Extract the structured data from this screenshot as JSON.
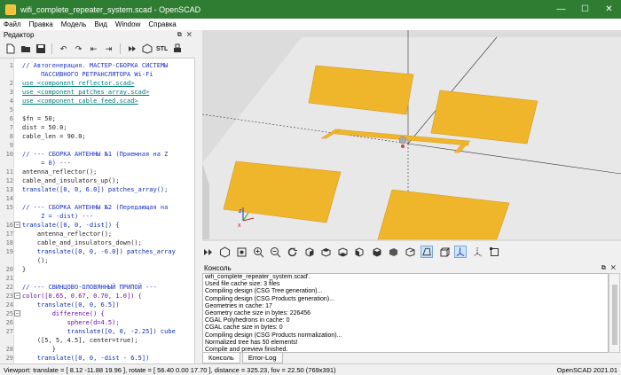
{
  "window": {
    "title": "wifi_complete_repeater_system.scad - OpenSCAD"
  },
  "menu": [
    "Файл",
    "Правка",
    "Модель",
    "Вид",
    "Window",
    "Справка"
  ],
  "editor": {
    "title": "Редактор",
    "export_label": "STL",
    "lines": [
      {
        "n": "1",
        "t": "// Автогенерация. МАСТЕР-СБОРКА СИСТЕМЫ",
        "c": "comment"
      },
      {
        "n": "",
        "t": "     ПАССИВНОГО РЕТРАНСЛЯТОРА Wi-Fi",
        "c": "comment"
      },
      {
        "n": "2",
        "t": "use <component_reflector.scad>",
        "c": "use"
      },
      {
        "n": "3",
        "t": "use <component_patches_array.scad>",
        "c": "use"
      },
      {
        "n": "4",
        "t": "use <component_cable_feed.scad>",
        "c": "use"
      },
      {
        "n": "5",
        "t": "",
        "c": "plain"
      },
      {
        "n": "6",
        "t": "$fn = 50;",
        "c": "plain"
      },
      {
        "n": "7",
        "t": "dist = 50.0;",
        "c": "plain"
      },
      {
        "n": "8",
        "t": "cable_len = 90.0;",
        "c": "plain"
      },
      {
        "n": "9",
        "t": "",
        "c": "plain"
      },
      {
        "n": "10",
        "t": "// --- СБОРКА АНТЕННЫ №1 (Приемная на Z",
        "c": "comment"
      },
      {
        "n": "",
        "t": "     = 0) ---",
        "c": "comment"
      },
      {
        "n": "11",
        "t": "antenna_reflector();",
        "c": "plain"
      },
      {
        "n": "12",
        "t": "cable_and_insulators_up();",
        "c": "plain"
      },
      {
        "n": "13",
        "t": "translate([0, 0, 6.0]) patches_array();",
        "c": "kw"
      },
      {
        "n": "14",
        "t": "",
        "c": "plain"
      },
      {
        "n": "15",
        "t": "// --- СБОРКА АНТЕННЫ №2 (Передающая на",
        "c": "comment"
      },
      {
        "n": "",
        "t": "     Z = -dist) ---",
        "c": "comment"
      },
      {
        "n": "16",
        "t": "translate([0, 0, -dist]) {",
        "c": "kw",
        "fold": true
      },
      {
        "n": "17",
        "t": "    antenna_reflector();",
        "c": "plain"
      },
      {
        "n": "18",
        "t": "    cable_and_insulators_down();",
        "c": "plain"
      },
      {
        "n": "19",
        "t": "    translate([0, 0, -6.0]) patches_array",
        "c": "kw"
      },
      {
        "n": "",
        "t": "    ();",
        "c": "plain"
      },
      {
        "n": "20",
        "t": "}",
        "c": "plain"
      },
      {
        "n": "21",
        "t": "",
        "c": "plain"
      },
      {
        "n": "22",
        "t": "// --- СВИНЦОВО-ОЛОВЯННЫЙ ПРИПОЙ ---",
        "c": "comment"
      },
      {
        "n": "23",
        "t": "color([0.65, 0.67, 0.70, 1.0]) {",
        "c": "fn",
        "fold": true
      },
      {
        "n": "24",
        "t": "    translate([0, 0, 6.5])",
        "c": "kw"
      },
      {
        "n": "25",
        "t": "        difference() {",
        "c": "fn",
        "fold": true
      },
      {
        "n": "26",
        "t": "            sphere(d=4.5);",
        "c": "fn"
      },
      {
        "n": "27",
        "t": "            translate([0, 0, -2.25]) cube",
        "c": "kw"
      },
      {
        "n": "",
        "t": "    ([5, 5, 4.5], center=true);",
        "c": "plain"
      },
      {
        "n": "28",
        "t": "        }",
        "c": "plain"
      },
      {
        "n": "29",
        "t": "    translate([0, 0, -dist - 6.5])",
        "c": "kw"
      },
      {
        "n": "30",
        "t": "        difference() {",
        "c": "fn"
      }
    ]
  },
  "console": {
    "title": "Консоль",
    "lines": [
      "wifi_complete_repeater_system.scad'.",
      "Used file cache size: 3 files",
      "Compiling design (CSG Tree generation)...",
      "Compiling design (CSG Products generation)...",
      "Geometries in cache: 17",
      "Geometry cache size in bytes: 226456",
      "CGAL Polyhedrons in cache: 0",
      "CGAL cache size in bytes: 0",
      "Compiling design (CSG Products normalization)...",
      "Normalized tree has 50 elements!",
      "Compile and preview finished."
    ],
    "tabs": [
      "Консоль",
      "Error-Log"
    ]
  },
  "status": {
    "viewport": "Viewport: translate = [ 8.12 -11.88 19.96 ], rotate = [ 56.40 0.00 17.70 ], distance = 325.23, fov = 22.50 (769x391)",
    "version": "OpenSCAD 2021.01"
  },
  "colors": {
    "patch": "#f0b62b",
    "title_bar": "#2e7d32",
    "reflector": "#f2f2f2"
  }
}
